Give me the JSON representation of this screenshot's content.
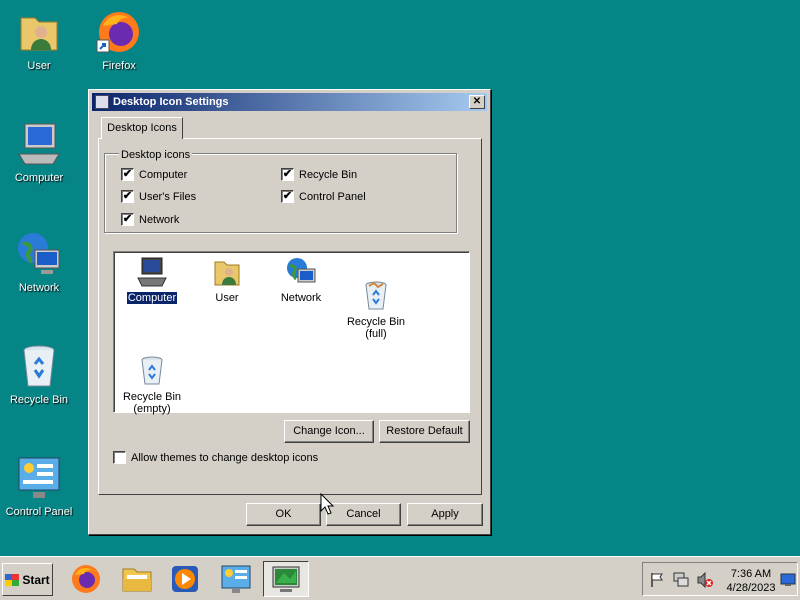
{
  "desktop": {
    "icons": [
      {
        "label": "User",
        "icon": "user-folder-icon"
      },
      {
        "label": "Firefox",
        "icon": "firefox-icon"
      },
      {
        "label": "Computer",
        "icon": "computer-icon"
      },
      {
        "label": "Network",
        "icon": "network-globe-icon"
      },
      {
        "label": "Recycle Bin",
        "icon": "recycle-bin-icon"
      },
      {
        "label": "Control Panel",
        "icon": "control-panel-icon"
      }
    ]
  },
  "dialog": {
    "title": "Desktop Icon Settings",
    "close_glyph": "✕",
    "tab_label": "Desktop Icons",
    "group_label": "Desktop icons",
    "checkboxes": [
      {
        "label": "Computer",
        "checked": true
      },
      {
        "label": "User's Files",
        "checked": true
      },
      {
        "label": "Network",
        "checked": true
      },
      {
        "label": "Recycle Bin",
        "checked": true
      },
      {
        "label": "Control Panel",
        "checked": true
      }
    ],
    "list_items": [
      {
        "label": "Computer",
        "selected": true,
        "icon": "computer-icon"
      },
      {
        "label": "User",
        "icon": "user-folder-icon"
      },
      {
        "label": "Network",
        "icon": "network-globe-icon"
      },
      {
        "label": "Recycle Bin\n(full)",
        "icon": "recycle-bin-full-icon"
      },
      {
        "label": "Recycle Bin\n(empty)",
        "icon": "recycle-bin-empty-icon"
      }
    ],
    "change_icon_label": "Change Icon...",
    "restore_default_label": "Restore Default",
    "allow_themes_label": "Allow themes to change desktop icons",
    "allow_themes_checked": false,
    "check_glyph": "✔",
    "ok_label": "OK",
    "cancel_label": "Cancel",
    "apply_label": "Apply"
  },
  "taskbar": {
    "start_label": "Start",
    "buttons": [
      "firefox-icon",
      "file-explorer-icon",
      "media-player-icon",
      "control-panel-icon",
      "desktop-icon-settings-icon"
    ],
    "tray_icons": [
      "action-center-flag-icon",
      "network-status-icon",
      "volume-muted-icon"
    ],
    "time": "7:36 AM",
    "date": "4/28/2023"
  }
}
